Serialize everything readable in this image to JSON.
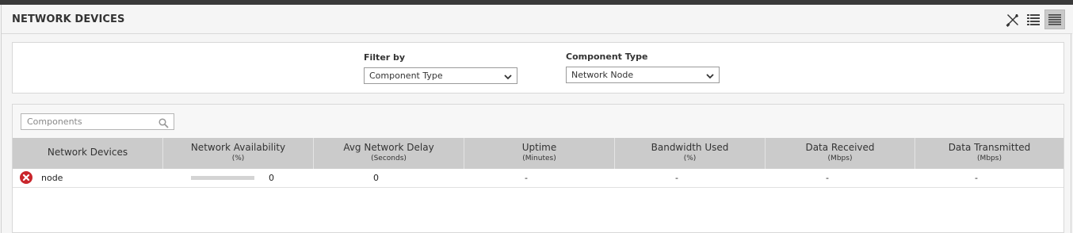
{
  "panel": {
    "title": "NETWORK DEVICES"
  },
  "header_icons": [
    "tools-icon",
    "list-view-icon",
    "detail-view-icon"
  ],
  "filter": {
    "filter_by_label": "Filter by",
    "filter_by_value": "Component Type",
    "component_type_label": "Component Type",
    "component_type_value": "Network Node"
  },
  "search": {
    "placeholder": "Components"
  },
  "table": {
    "columns": [
      {
        "title": "Network Devices",
        "unit": ""
      },
      {
        "title": "Network Availability",
        "unit": "(%)"
      },
      {
        "title": "Avg Network Delay",
        "unit": "(Seconds)"
      },
      {
        "title": "Uptime",
        "unit": "(Minutes)"
      },
      {
        "title": "Bandwidth Used",
        "unit": "(%)"
      },
      {
        "title": "Data Received",
        "unit": "(Mbps)"
      },
      {
        "title": "Data Transmitted",
        "unit": "(Mbps)"
      }
    ],
    "rows": [
      {
        "status": "error",
        "name": "node",
        "availability_fraction": 0,
        "availability": "0",
        "avg_delay": "0",
        "uptime": "-",
        "bandwidth": "-",
        "received": "-",
        "transmitted": "-"
      }
    ]
  },
  "colors": {
    "header_bg": "#cbcbcb",
    "error": "#c9262c"
  }
}
